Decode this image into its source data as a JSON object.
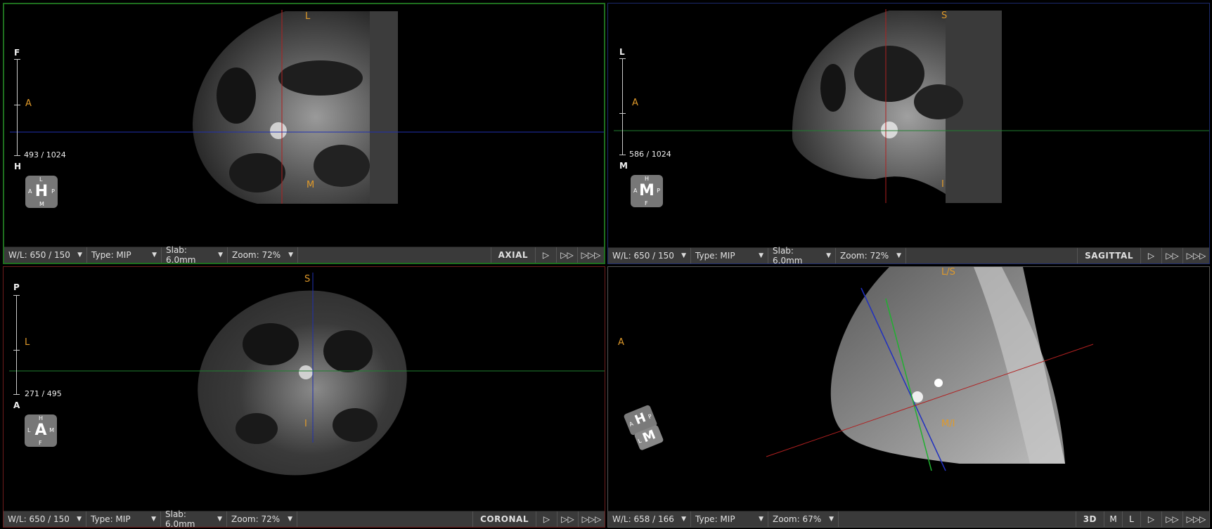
{
  "viewports": {
    "axial": {
      "label": "AXIAL",
      "wl": "W/L: 650 / 150",
      "type": "Type: MIP",
      "slab": "Slab: 6.0mm",
      "zoom": "Zoom: 72%",
      "orient": {
        "top": "L",
        "left": "A",
        "bottom": "M"
      },
      "scale_top": "F",
      "scale_bottom": "H",
      "slice": "493 / 1024",
      "cube": {
        "big": "H",
        "top": "L",
        "left": "A",
        "right": "P",
        "bottom": "M"
      }
    },
    "sagittal": {
      "label": "SAGITTAL",
      "wl": "W/L: 650 / 150",
      "type": "Type: MIP",
      "slab": "Slab: 6.0mm",
      "zoom": "Zoom: 72%",
      "orient": {
        "top": "S",
        "left": "A",
        "bottom": "I"
      },
      "scale_top": "L",
      "scale_bottom": "M",
      "slice": "586 / 1024",
      "cube": {
        "big": "M",
        "top": "H",
        "left": "A",
        "right": "P",
        "bottom": "F"
      }
    },
    "coronal": {
      "label": "CORONAL",
      "wl": "W/L: 650 / 150",
      "type": "Type: MIP",
      "slab": "Slab: 6.0mm",
      "zoom": "Zoom: 72%",
      "orient": {
        "top": "S",
        "left": "L",
        "bottom": "I"
      },
      "scale_top": "P",
      "scale_bottom": "A",
      "slice": "271 / 495",
      "cube": {
        "big": "A",
        "top": "H",
        "left": "L",
        "right": "M",
        "bottom": "F"
      }
    },
    "threed": {
      "label": "3D",
      "wl": "W/L: 658 / 166",
      "type": "Type: MIP",
      "zoom": "Zoom: 67%",
      "orient": {
        "top": "L/S",
        "left": "A",
        "bottom": "M/I"
      },
      "btn_m": "M",
      "btn_l": "L",
      "cube": {
        "top_face": "H",
        "front_face": "M",
        "a": "A",
        "p": "P",
        "l": "L"
      }
    }
  },
  "icons": {
    "chevron": "chevron-down-icon",
    "play": "play-icon",
    "play2": "fast-forward-icon",
    "play3": "faster-forward-icon"
  },
  "colors": {
    "orient_text": "#e09a2a",
    "axial_border": "#1e6e1e",
    "sagittal_border": "#1c2a6e",
    "coronal_border": "#6e1c1c"
  }
}
